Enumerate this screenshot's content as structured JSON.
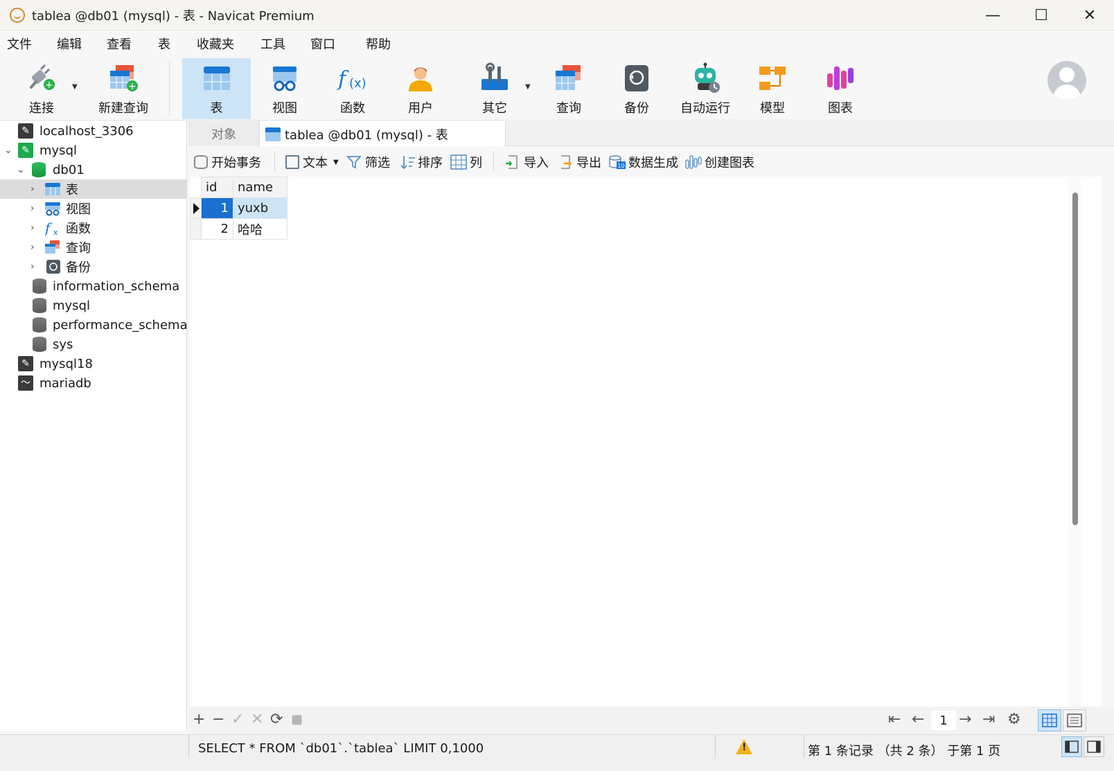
{
  "window": {
    "title": "tablea @db01 (mysql) - 表 - Navicat Premium",
    "controls": {
      "minimize": "—",
      "maximize": "☐",
      "close": "✕"
    }
  },
  "menu": [
    "文件",
    "编辑",
    "查看",
    "表",
    "收藏夹",
    "工具",
    "窗口",
    "帮助"
  ],
  "toolbar": {
    "connect": "连接",
    "new_query": "新建查询",
    "table": "表",
    "view": "视图",
    "function": "函数",
    "user": "用户",
    "other": "其它",
    "query": "查询",
    "backup": "备份",
    "automation": "自动运行",
    "model": "模型",
    "chart": "图表"
  },
  "sidebar": {
    "items": [
      {
        "label": "localhost_3306",
        "icon": "mysql-connection-icon"
      },
      {
        "label": "mysql",
        "icon": "mysql-connection-icon"
      },
      {
        "label": "db01",
        "icon": "database-icon"
      },
      {
        "label": "表",
        "icon": "table-icon"
      },
      {
        "label": "视图",
        "icon": "view-icon"
      },
      {
        "label": "函数",
        "icon": "function-icon"
      },
      {
        "label": "查询",
        "icon": "query-icon"
      },
      {
        "label": "备份",
        "icon": "backup-icon"
      },
      {
        "label": "information_schema",
        "icon": "database-icon"
      },
      {
        "label": "mysql",
        "icon": "database-icon"
      },
      {
        "label": "performance_schema",
        "icon": "database-icon"
      },
      {
        "label": "sys",
        "icon": "database-icon"
      },
      {
        "label": "mysql18",
        "icon": "mysql-connection-icon"
      },
      {
        "label": "mariadb",
        "icon": "mariadb-connection-icon"
      }
    ]
  },
  "tabs": {
    "objects": "对象",
    "active": "tablea @db01 (mysql) - 表"
  },
  "subtoolbar": {
    "begin_transaction": "开始事务",
    "text": "文本",
    "filter": "筛选",
    "sort": "排序",
    "columns": "列",
    "import": "导入",
    "export": "导出",
    "data_generation": "数据生成",
    "create_chart": "创建图表"
  },
  "table": {
    "columns": [
      "id",
      "name"
    ],
    "rows": [
      {
        "id": "1",
        "name": "yuxb"
      },
      {
        "id": "2",
        "name": "哈哈"
      }
    ]
  },
  "navbar": {
    "add": "+",
    "delete": "−",
    "apply": "✓",
    "cancel": "✕",
    "refresh": "⟳",
    "stop": "■",
    "first": "⇤",
    "prev": "←",
    "page": "1",
    "next": "→",
    "last": "⇥",
    "settings": "⚙"
  },
  "status": {
    "sql": "SELECT * FROM `db01`.`tablea` LIMIT 0,1000",
    "warning": "!",
    "records": "第 1 条记录 （共 2 条） 于第 1 页"
  },
  "colors": {
    "accent": "#1a6fd1",
    "active_bg": "#cde4f7",
    "selected_row": "#dcdcdc",
    "green": "#1ea84b"
  }
}
